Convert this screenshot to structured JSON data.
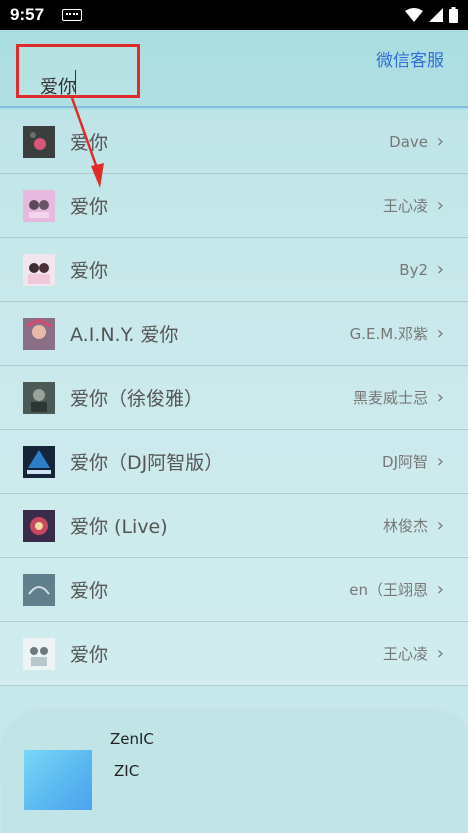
{
  "status_bar": {
    "time": "9:57"
  },
  "search": {
    "query": "爱你"
  },
  "header": {
    "service_label": "微信客服"
  },
  "songs": [
    {
      "title": "爱你",
      "artist": "Dave"
    },
    {
      "title": "爱你",
      "artist": "王心凌"
    },
    {
      "title": "爱你",
      "artist": "By2"
    },
    {
      "title": "A.I.N.Y. 爱你",
      "artist": "G.E.M.邓紫"
    },
    {
      "title": "爱你（徐俊雅）",
      "artist": "黑麦威士忌"
    },
    {
      "title": "爱你（DJ阿智版）",
      "artist": "DJ阿智"
    },
    {
      "title": "爱你 (Live)",
      "artist": "林俊杰"
    },
    {
      "title": "爱你",
      "artist": "en（王翊恩"
    },
    {
      "title": "爱你",
      "artist": "王心凌"
    }
  ],
  "player": {
    "title": "ZenIC",
    "artist": "ZIC"
  },
  "colors": {
    "annotation": "#e02b2b",
    "link": "#2f6fd9"
  }
}
